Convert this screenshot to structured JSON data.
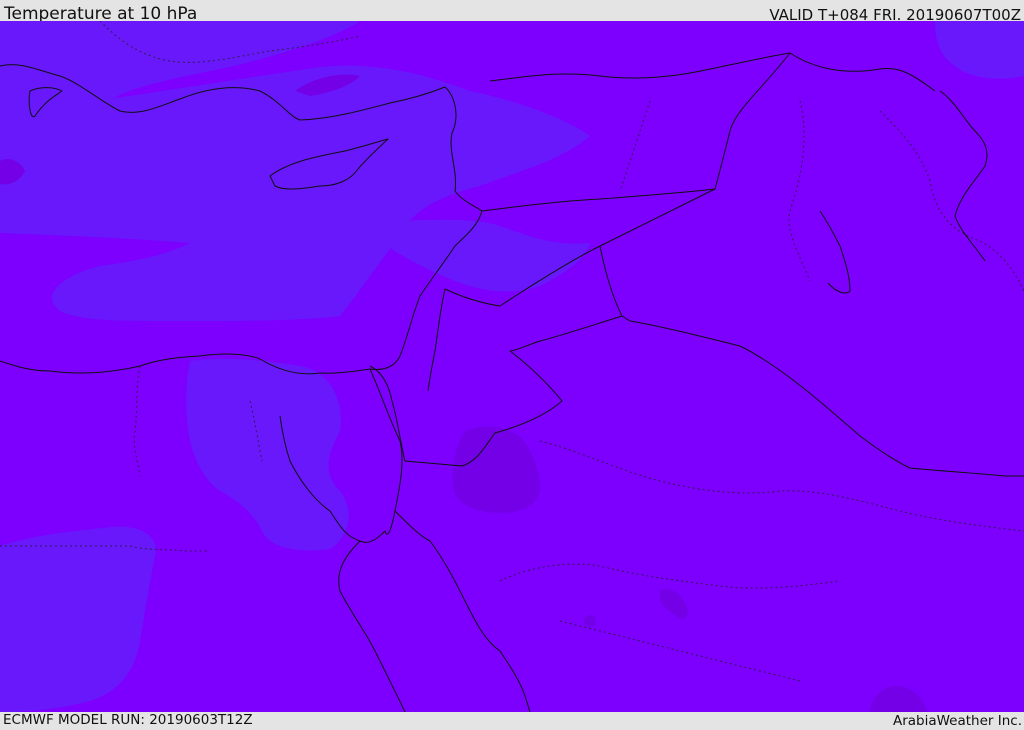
{
  "header": {
    "title": "Temperature at 10 hPa",
    "valid": "VALID T+084 FRI. 20190607T00Z"
  },
  "footer": {
    "model_run": "ECMWF MODEL RUN: 20190603T12Z",
    "credit": "ArabiaWeather Inc."
  },
  "map": {
    "colors": {
      "background_field": "#7d00fe",
      "cooler_field": "#6818fb",
      "warmer_field": "#7400e8",
      "header_bar": "#e4e4e4"
    }
  }
}
